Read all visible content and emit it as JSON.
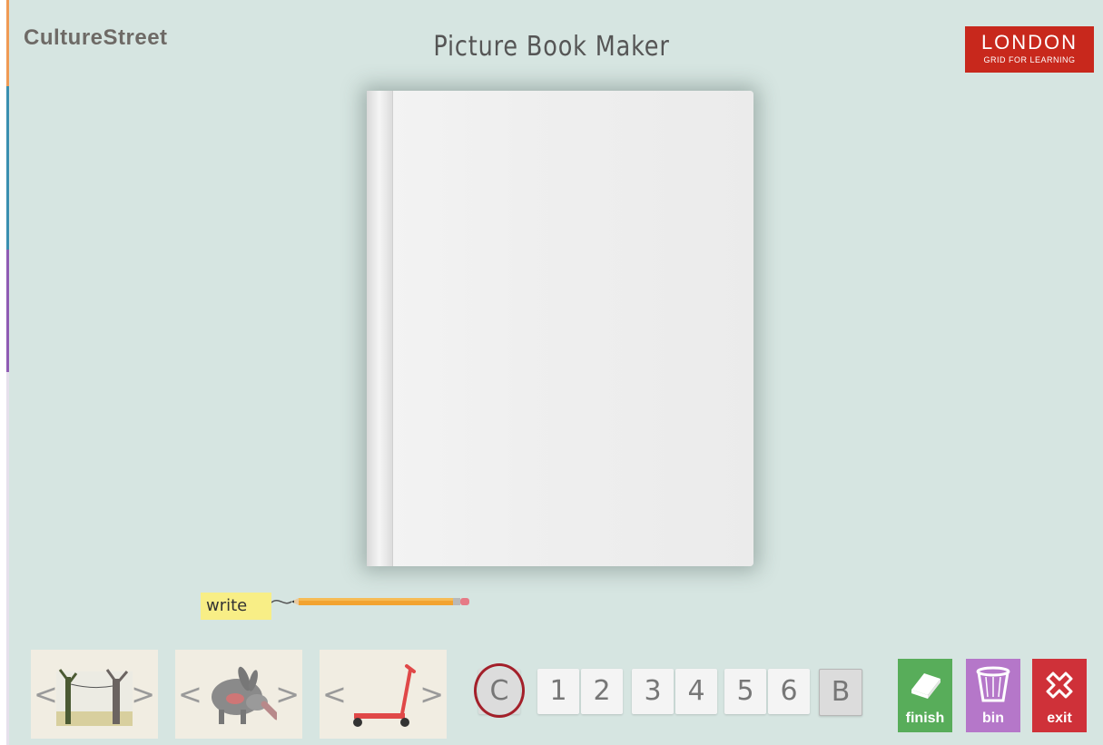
{
  "header": {
    "brand": "CultureStreet",
    "title": "Picture Book Maker",
    "logo_line1": "LONDON",
    "logo_line2": "GRID FOR LEARNING"
  },
  "tool": {
    "write_label": "write"
  },
  "asset_carousels": [
    {
      "name": "background",
      "picture": "trees-and-swing-icon"
    },
    {
      "name": "character",
      "picture": "aardvark-icon"
    },
    {
      "name": "object",
      "picture": "red-scooter-icon"
    }
  ],
  "pages": {
    "cover_label": "C",
    "items": [
      "1",
      "2",
      "3",
      "4",
      "5",
      "6"
    ],
    "back_label": "B",
    "selected": "C"
  },
  "actions": {
    "finish_label": "finish",
    "bin_label": "bin",
    "exit_label": "exit"
  },
  "colors": {
    "background": "#d6e5e1",
    "logo": "#c8281c",
    "finish": "#58ad5a",
    "bin": "#b577c9",
    "exit": "#cf3139",
    "selected_ring": "#a3202a"
  }
}
